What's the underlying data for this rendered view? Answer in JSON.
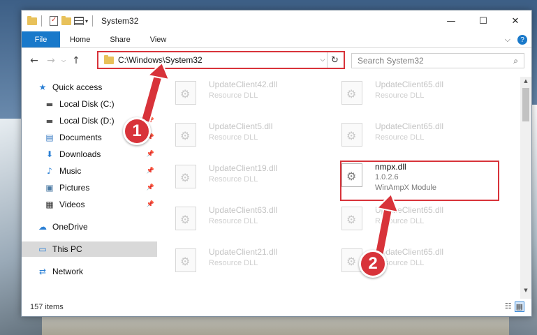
{
  "window": {
    "title": "System32",
    "controls": {
      "minimize": "—",
      "maximize": "☐",
      "close": "✕"
    }
  },
  "ribbon": {
    "file_tab": "File",
    "tabs": [
      "Home",
      "Share",
      "View"
    ],
    "expand_icon": "⌵",
    "help_icon": "?"
  },
  "navigation": {
    "back": "←",
    "forward": "→",
    "recent": "⌵",
    "up": "↑",
    "address": "C:\\Windows\\System32",
    "address_dropdown": "⌵",
    "refresh": "↻",
    "search_placeholder": "Search System32",
    "search_icon": "⌕"
  },
  "sidebar": {
    "items": [
      {
        "label": "Quick access",
        "icon": "★",
        "pinned": false
      },
      {
        "label": "Local Disk (C:)",
        "icon": "▬",
        "pinned": true
      },
      {
        "label": "Local Disk (D:)",
        "icon": "▬",
        "pinned": true
      },
      {
        "label": "Documents",
        "icon": "▤",
        "pinned": true
      },
      {
        "label": "Downloads",
        "icon": "⬇",
        "pinned": true
      },
      {
        "label": "Music",
        "icon": "♪",
        "pinned": true
      },
      {
        "label": "Pictures",
        "icon": "▣",
        "pinned": true
      },
      {
        "label": "Videos",
        "icon": "▦",
        "pinned": true
      },
      {
        "label": "OneDrive",
        "icon": "☁",
        "pinned": false
      },
      {
        "label": "This PC",
        "icon": "▭",
        "pinned": false
      },
      {
        "label": "Network",
        "icon": "⇄",
        "pinned": false
      }
    ],
    "pin_glyph": "📌"
  },
  "files": {
    "left_column": [
      {
        "name": "UpdateClient42.dll",
        "desc": "Resource DLL"
      },
      {
        "name": "UpdateClient5.dll",
        "desc": "Resource DLL"
      },
      {
        "name": "UpdateClient19.dll",
        "desc": "Resource DLL"
      },
      {
        "name": "UpdateClient63.dll",
        "desc": "Resource DLL"
      },
      {
        "name": "UpdateClient21.dll",
        "desc": "Resource DLL"
      }
    ],
    "right_column": [
      {
        "name": "UpdateClient65.dll",
        "desc": "Resource DLL"
      },
      {
        "name": "UpdateClient65.dll",
        "desc": "Resource DLL"
      },
      {
        "name": "UpdateClient65.dll",
        "desc": "Resource DLL"
      },
      {
        "name": "UpdateClient65.dll",
        "desc": "Resource DLL"
      }
    ],
    "highlighted": {
      "name": "nmpx.dll",
      "version": "1.0.2.6",
      "desc": "WinAmpX Module"
    }
  },
  "status": {
    "item_count": "157 items"
  },
  "view_buttons": {
    "details": "☷",
    "tiles": "▦"
  },
  "annotations": {
    "step1": "1",
    "step2": "2"
  },
  "colors": {
    "accent": "#1979ca",
    "highlight_red": "#d8333a",
    "selection": "#d9d9d9"
  }
}
